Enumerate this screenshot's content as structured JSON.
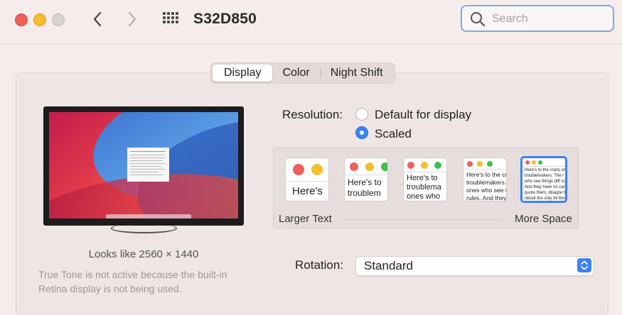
{
  "window": {
    "title": "S32D850"
  },
  "search": {
    "placeholder": "Search",
    "value": ""
  },
  "tabs": [
    {
      "label": "Display",
      "active": true
    },
    {
      "label": "Color",
      "active": false
    },
    {
      "label": "Night Shift",
      "active": false
    }
  ],
  "display": {
    "looks_like": "Looks like 2560 × 1440",
    "true_tone_note": "True Tone is not active because the built-in Retina display is not being used."
  },
  "resolution": {
    "label": "Resolution:",
    "options": [
      {
        "label": "Default for display",
        "selected": false
      },
      {
        "label": "Scaled",
        "selected": true
      }
    ],
    "scale_previews": [
      {
        "text": "Here's",
        "selected": false
      },
      {
        "text": "Here's to troublem",
        "selected": false
      },
      {
        "text": "Here's to troublema ones who",
        "selected": false
      },
      {
        "text": "Here's to the cr troublemakers. ones who see t rules. And they",
        "selected": false
      },
      {
        "text": "Here's to the crazy one troublemakers. The r ones who see things diff rules. And they have no can quote them, disagre them. About the only thi Because they change th",
        "selected": true
      }
    ],
    "slider_left_label": "Larger Text",
    "slider_right_label": "More Space"
  },
  "rotation": {
    "label": "Rotation:",
    "value": "Standard"
  },
  "colors": {
    "accent": "#3a82f7",
    "close": "#ee5f5a",
    "minimize": "#f6bd2e",
    "thumb_green": "#3fbf4f"
  }
}
